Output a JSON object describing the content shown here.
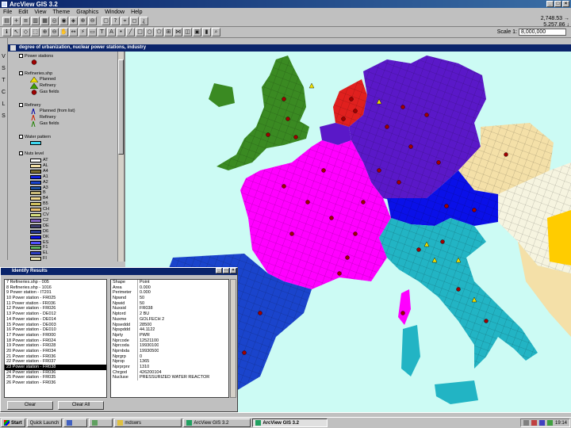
{
  "app": {
    "title": "ArcView GIS 3.2"
  },
  "menu": [
    "File",
    "Edit",
    "View",
    "Theme",
    "Graphics",
    "Window",
    "Help"
  ],
  "scale": {
    "label": "Scale 1:",
    "value": "8,000,000"
  },
  "coords": {
    "x": "2,748.53 →",
    "y": "5,257.86 ↓"
  },
  "view": {
    "title": "degree of urbanization, nuclear power stations, industry",
    "themes": [
      {
        "name": "Power stations",
        "symbols": []
      },
      {
        "name": "Refineries.shp",
        "symbols": [
          "Planned",
          "Refinery",
          "Gas fields"
        ]
      },
      {
        "name": "Refinery",
        "symbols": [
          "Planned (from list)",
          "Refinery",
          "Gas fields"
        ]
      },
      {
        "name": "Water pattern",
        "symbols": []
      },
      {
        "name": "Nuts level",
        "symbols": [
          "AT",
          "AL",
          "A4",
          "A1",
          "A2",
          "A3",
          "B",
          "B4",
          "B5",
          "CH",
          "CV",
          "C2",
          "DE",
          "D6",
          "DK",
          "ES",
          "F1",
          "EL",
          "FI"
        ]
      }
    ]
  },
  "identify": {
    "title": "Identify Results",
    "list": [
      "7 Refineries.shp - 005",
      "8 Refineries.shp - 1016",
      "9 Power station - IT201",
      "10 Power station - FR025",
      "11 Power station - FR036",
      "12 Power station - FR026",
      "13 Power station - DE012",
      "14 Power station - DE014",
      "15 Power station - DE003",
      "16 Power station - DE010",
      "17 Power station - FR000",
      "18 Power station - FR024",
      "19 Power station - FR028",
      "20 Power station - FR034",
      "21 Power station - FR036",
      "22 Power station - FR037",
      "23 Power station - FR038",
      "24 Power station - FR036",
      "25 Power station - FR035",
      "26 Power station - FR036"
    ],
    "selected_index": 16,
    "fields": [
      {
        "f": "Shape",
        "v": "Point"
      },
      {
        "f": "Area",
        "v": "0.000"
      },
      {
        "f": "Perimeter",
        "v": "0.000"
      },
      {
        "f": "Npwnd",
        "v": "50"
      },
      {
        "f": "Npwid",
        "v": "50"
      },
      {
        "f": "Nuxsid",
        "v": "FR038"
      },
      {
        "f": "Nptord",
        "v": "2 BU"
      },
      {
        "f": "Nuxme",
        "v": "GOLFECH 2"
      },
      {
        "f": "Npseddd",
        "v": "28500"
      },
      {
        "f": "Npspddd",
        "v": "44.1122"
      },
      {
        "f": "Nprty",
        "v": "PWR"
      },
      {
        "f": "Nprcode",
        "v": "12521100"
      },
      {
        "f": "Nprcoda",
        "v": "19930100"
      },
      {
        "f": "Nprnbda",
        "v": "19930500"
      },
      {
        "f": "Nprgrp",
        "v": "0"
      },
      {
        "f": "Nprop",
        "v": "1365"
      },
      {
        "f": "Nprprpnr",
        "v": "1310"
      },
      {
        "f": "Chrgod",
        "v": "426200104"
      },
      {
        "f": "Nucluse",
        "v": "PRESSURIZED WATER REACTOR"
      }
    ],
    "buttons": {
      "clear": "Clear",
      "clear_all": "Clear All"
    }
  },
  "taskbar": {
    "start": "Start",
    "quicklaunch": "Quick Launch",
    "items": [
      "",
      "",
      "mdswrs",
      "ArcView GIS 3.2",
      "ArcView GIS 3.2"
    ],
    "clock": "19:14"
  },
  "colors": {
    "sea": "#ccfbf4",
    "france": "#ff00ff",
    "germany": "#5a18c8",
    "uk": "#3a8a22",
    "netherlands": "#e0201e",
    "switzerland": "#0a10e8",
    "italy": "#22b4c4",
    "austria_cz": "#f4e0a8",
    "iberia": "#1a44cc"
  }
}
